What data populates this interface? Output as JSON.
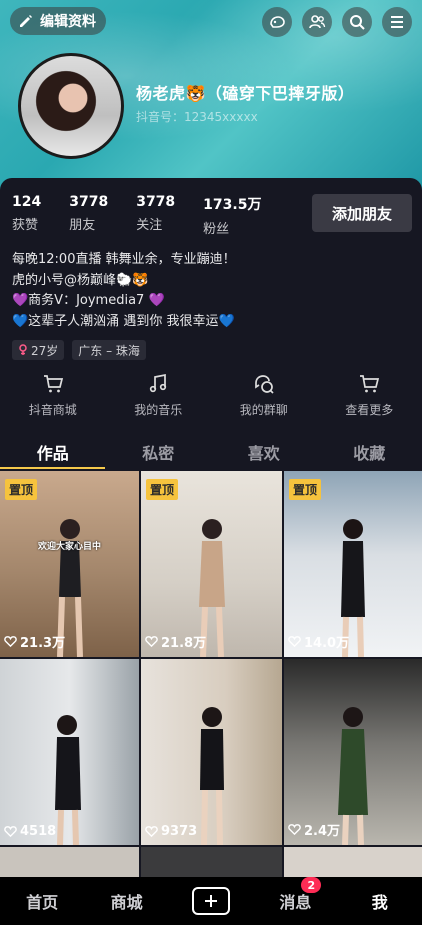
{
  "header": {
    "edit_label": "编辑资料",
    "icons": [
      "visitor-icon",
      "friends-icon",
      "search-icon",
      "menu-icon"
    ]
  },
  "profile": {
    "name": "杨老虎🐯（磕穿下巴摔牙版）",
    "account": "抖音号：12345xxxxx"
  },
  "stats": [
    {
      "value": "124",
      "label": "获赞"
    },
    {
      "value": "3778",
      "label": "朋友"
    },
    {
      "value": "3778",
      "label": "关注"
    },
    {
      "value": "173.5万",
      "label": "粉丝"
    }
  ],
  "add_friend_label": "添加朋友",
  "bio": [
    "每晚12:00直播 韩舞业余，专业蹦迪！",
    "虎的小号@杨巅峰🐑🐯",
    "💜商务V：Joymedia7 💜",
    "💙这辈子人潮汹涌 遇到你  我很幸运💙"
  ],
  "tags": [
    {
      "icon": "female-icon",
      "text": "27岁"
    },
    {
      "icon": "",
      "text": "广东 – 珠海"
    }
  ],
  "quick_links": [
    {
      "icon": "cart-icon",
      "label": "抖音商城"
    },
    {
      "icon": "music-note-icon",
      "label": "我的音乐"
    },
    {
      "icon": "group-chat-icon",
      "label": "我的群聊"
    },
    {
      "icon": "cart-more-icon",
      "label": "查看更多"
    }
  ],
  "tabs": [
    {
      "label": "作品",
      "active": true
    },
    {
      "label": "私密",
      "active": false
    },
    {
      "label": "喜欢",
      "active": false
    },
    {
      "label": "收藏",
      "active": false
    }
  ],
  "videos": [
    {
      "pinned": true,
      "pin_label": "置顶",
      "likes": "21.3万",
      "caption": "欢迎大家心目中"
    },
    {
      "pinned": true,
      "pin_label": "置顶",
      "likes": "21.8万",
      "caption": ""
    },
    {
      "pinned": true,
      "pin_label": "置顶",
      "likes": "14.0万",
      "caption": ""
    },
    {
      "pinned": false,
      "pin_label": "",
      "likes": "4518",
      "caption": ""
    },
    {
      "pinned": false,
      "pin_label": "",
      "likes": "9373",
      "caption": ""
    },
    {
      "pinned": false,
      "pin_label": "",
      "likes": "2.4万",
      "caption": ""
    }
  ],
  "nav": [
    {
      "label": "首页",
      "active": false
    },
    {
      "label": "商城",
      "active": false
    },
    {
      "label": "",
      "active": false
    },
    {
      "label": "消息",
      "active": false,
      "badge": "2"
    },
    {
      "label": "我",
      "active": true
    }
  ],
  "colors": {
    "accent": "#f5c94b",
    "badge": "#fe2c55",
    "background": "#161722"
  }
}
